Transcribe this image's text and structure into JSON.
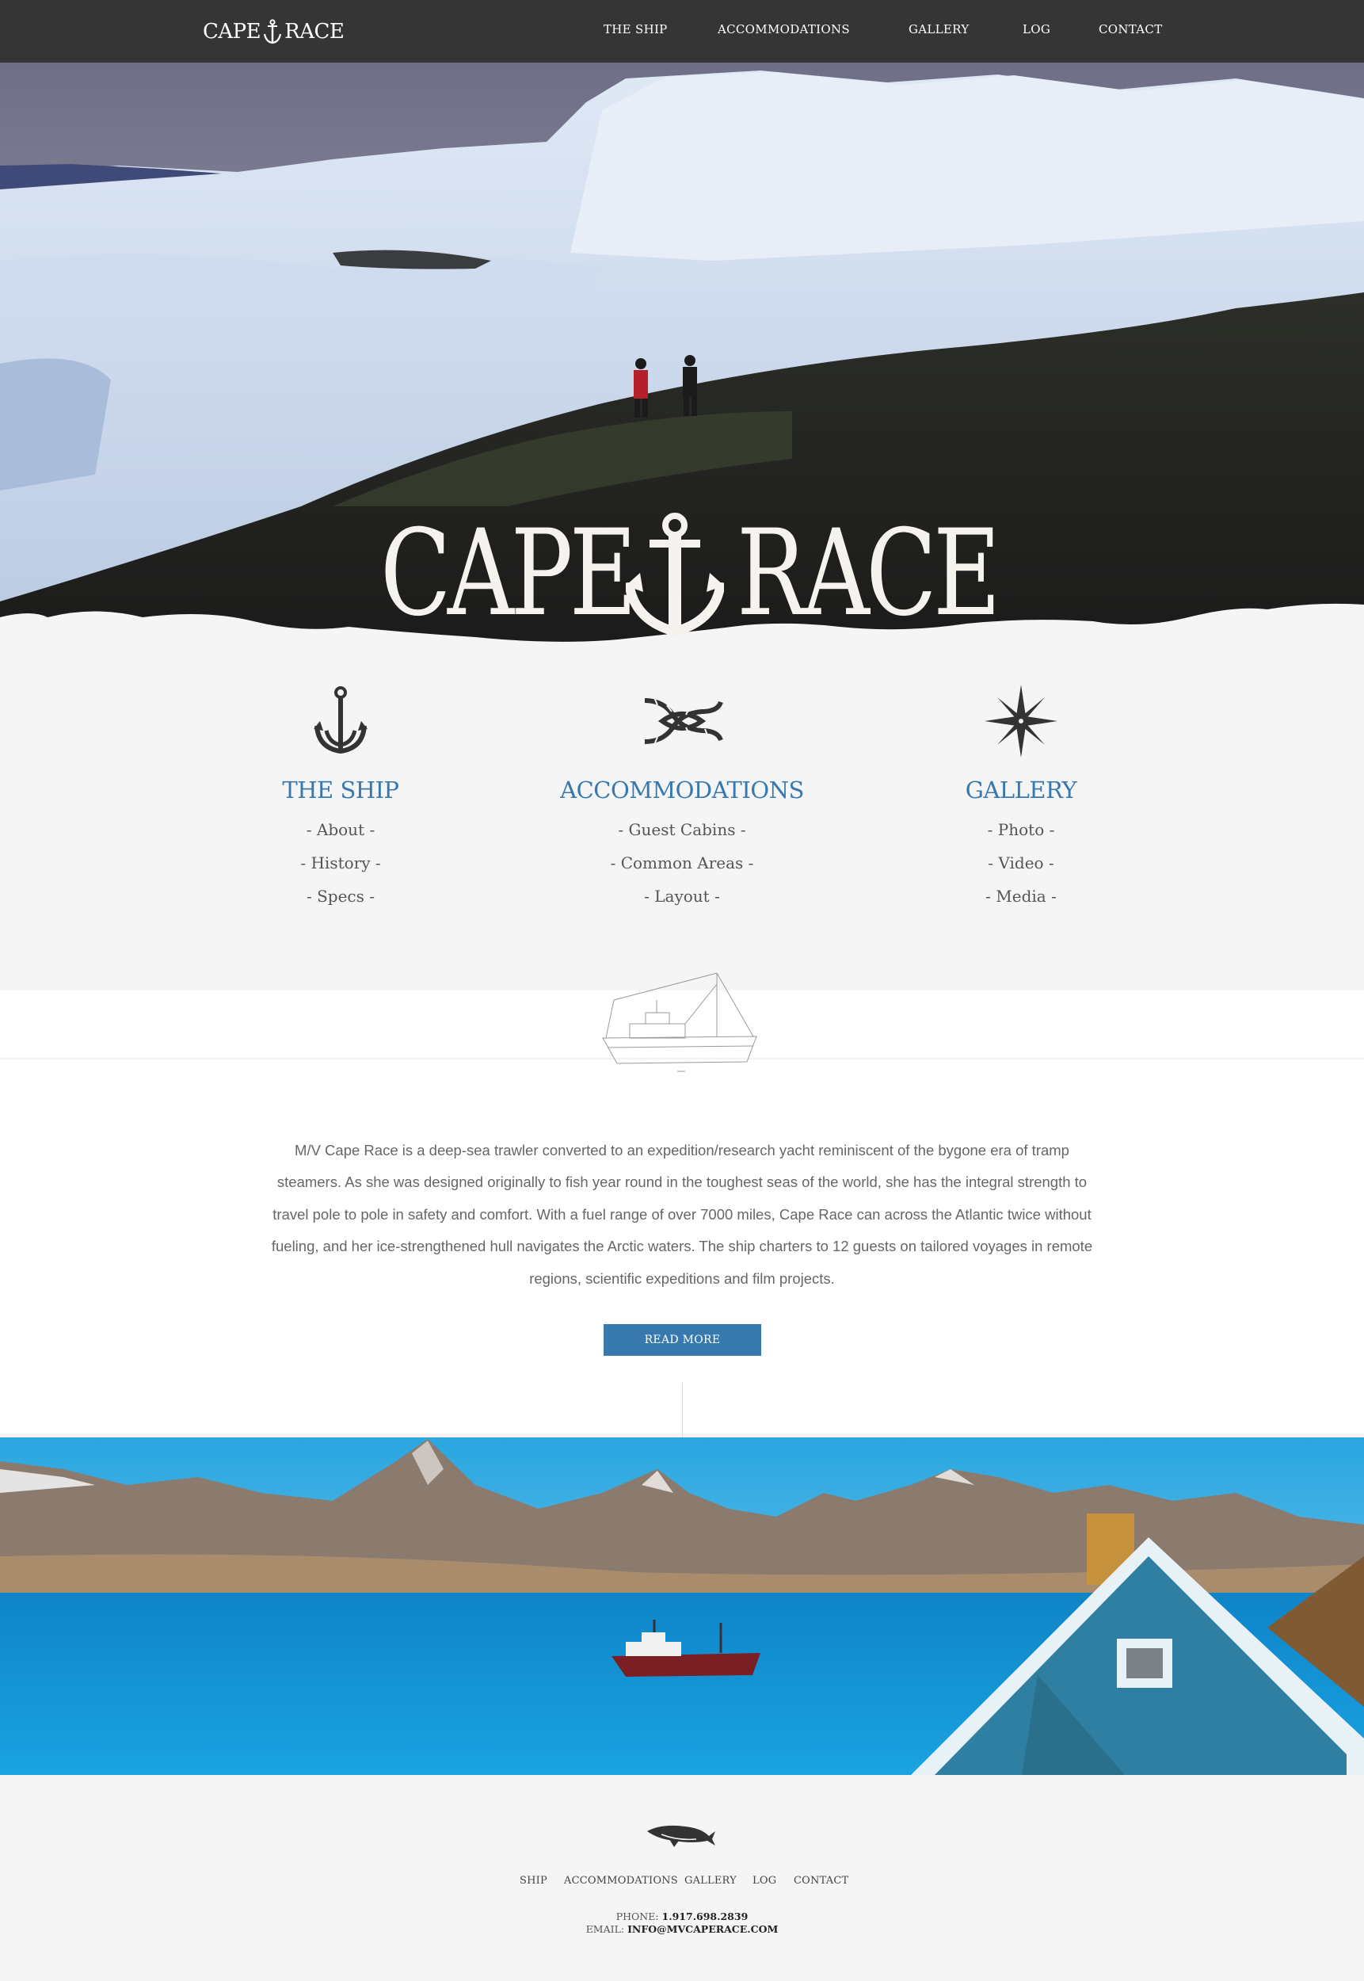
{
  "nav": {
    "logo_left": "CAPE",
    "logo_right": "RACE",
    "links": [
      "THE SHIP",
      "ACCOMMODATIONS",
      "GALLERY",
      "LOG",
      "CONTACT"
    ]
  },
  "hero": {
    "title_left": "CAPE",
    "title_right": "RACE"
  },
  "features": [
    {
      "icon": "anchor-icon",
      "title": "THE SHIP",
      "items": [
        "- About -",
        "- History -",
        "- Specs -"
      ]
    },
    {
      "icon": "rope-knot-icon",
      "title": "ACCOMMODATIONS",
      "items": [
        "- Guest Cabins -",
        "- Common Areas -",
        "- Layout -"
      ]
    },
    {
      "icon": "compass-star-icon",
      "title": "GALLERY",
      "items": [
        "- Photo -",
        "- Video -",
        "- Media -"
      ]
    }
  ],
  "intro": {
    "text": "M/V Cape Race is a deep-sea trawler converted to an expedition/research yacht reminiscent of the bygone era of tramp steamers. As she was designed originally to fish year round in the toughest seas of the world, she has the integral strength to travel pole to pole in safety and comfort. With a fuel range of over 7000 miles, Cape Race can across the Atlantic twice without fueling, and her ice-strengthened hull navigates the Arctic waters. The ship charters to 12 guests on tailored voyages in remote regions, scientific expeditions and film projects.",
    "button": "READ MORE"
  },
  "footer": {
    "links": [
      "SHIP",
      "ACCOMMODATIONS",
      "GALLERY",
      "LOG",
      "CONTACT"
    ],
    "phone_label": "PHONE:",
    "phone": "1.917.698.2839",
    "email_label": "EMAIL:",
    "email": "INFO@MVCAPERACE.COM"
  },
  "colors": {
    "nav_bg": "#353535",
    "accent": "#3779ae",
    "page_bg": "#f5f5f5"
  }
}
